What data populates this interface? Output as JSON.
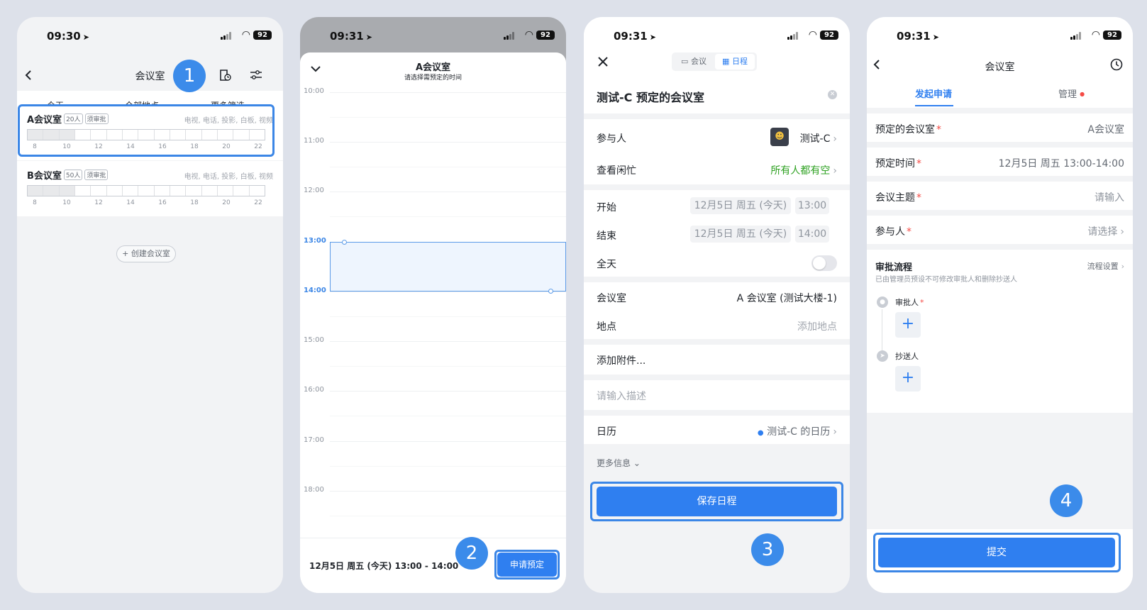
{
  "status": {
    "p1_time": "09:30",
    "p2_time": "09:31",
    "p3_time": "09:31",
    "p4_time": "09:31",
    "battery": "92"
  },
  "badges": [
    "1",
    "2",
    "3",
    "4"
  ],
  "p1": {
    "title": "会议室",
    "filters": {
      "today": "今天 ⌄",
      "location": "全部地点 ⌄",
      "more": "更多筛选 ⌄"
    },
    "rooms": [
      {
        "name": "A会议室",
        "capacity": "20人",
        "approval": "须审批",
        "equipment": "电视, 电话, 投影, 白板, 视频"
      },
      {
        "name": "B会议室",
        "capacity": "50人",
        "approval": "须审批",
        "equipment": "电视, 电话, 投影, 白板, 视频"
      }
    ],
    "ticks": [
      "8",
      "10",
      "12",
      "14",
      "16",
      "18",
      "20",
      "22"
    ],
    "create": "+ 创建会议室"
  },
  "p2": {
    "title": "A会议室",
    "subtitle": "请选择需预定的时间",
    "hours": [
      "10:00",
      "11:00",
      "12:00",
      "13:00",
      "14:00",
      "15:00",
      "16:00",
      "17:00",
      "18:00"
    ],
    "summary": "12月5日 周五 (今天) 13:00 - 14:00",
    "apply": "申请预定"
  },
  "p3": {
    "tab_meeting": "会议",
    "tab_schedule": "日程",
    "event_title": "测试-C 预定的会议室",
    "participants_label": "参与人",
    "participants_value": "测试-C",
    "busy_label": "查看闲忙",
    "busy_value": "所有人都有空",
    "start_label": "开始",
    "start_date": "12月5日 周五 (今天)",
    "start_time": "13:00",
    "end_label": "结束",
    "end_date": "12月5日 周五 (今天)",
    "end_time": "14:00",
    "allday_label": "全天",
    "room_label": "会议室",
    "room_value": "A 会议室 (测试大楼-1)",
    "location_label": "地点",
    "location_placeholder": "添加地点",
    "attachment": "添加附件...",
    "description_placeholder": "请输入描述",
    "calendar_label": "日历",
    "calendar_value": "测试-C 的日历",
    "more_info": "更多信息 ⌄",
    "save": "保存日程",
    "colors": {
      "green": "#2ea121",
      "blue": "#2f7ff0"
    }
  },
  "p4": {
    "title": "会议室",
    "tab_apply": "发起申请",
    "tab_manage": "管理",
    "room_label": "预定的会议室",
    "room_value": "A会议室",
    "time_label": "预定时间",
    "time_value": "12月5日 周五 13:00-14:00",
    "topic_label": "会议主题",
    "topic_placeholder": "请输入",
    "participants_label": "参与人",
    "participants_placeholder": "请选择",
    "flow_title": "审批流程",
    "flow_settings": "流程设置",
    "flow_note": "已由管理员预设不可修改审批人和删除抄送人",
    "approver": "审批人",
    "cc": "抄送人",
    "submit": "提交",
    "req_mark": "*"
  }
}
